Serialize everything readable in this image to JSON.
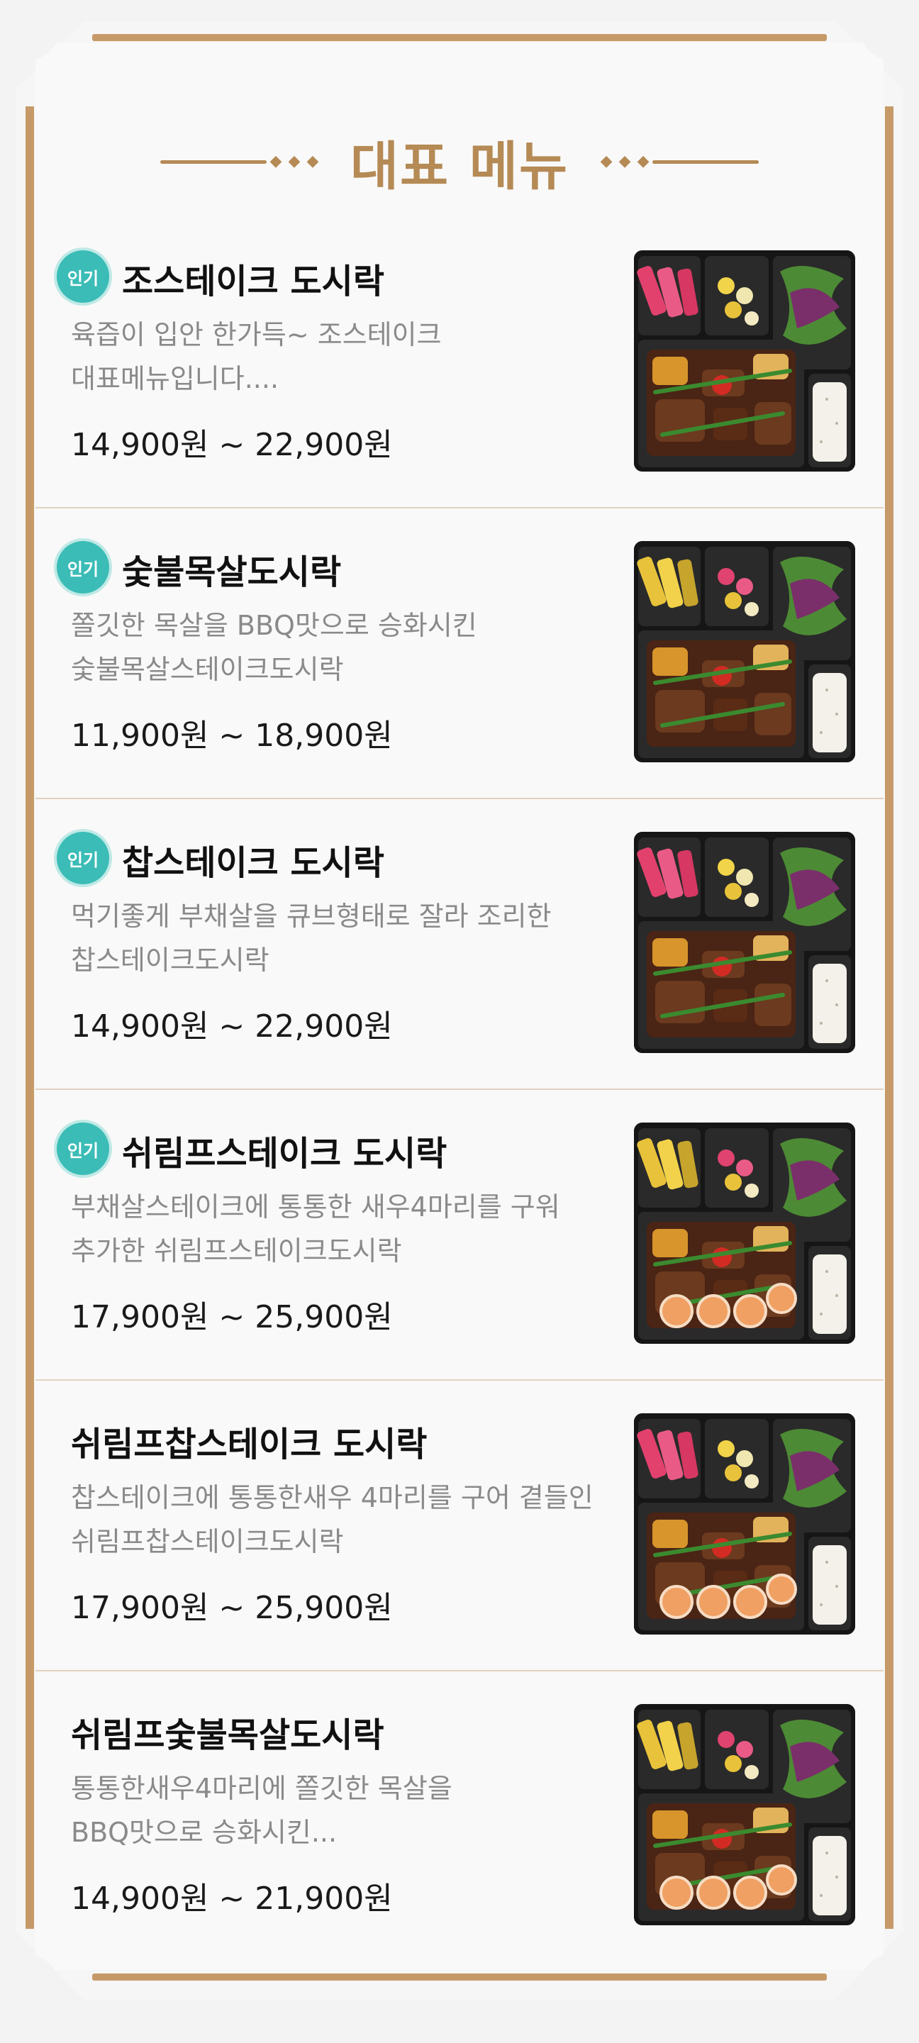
{
  "section": {
    "title": "대표 메뉴",
    "accent_color": "#b58a55",
    "badge_color": "#3bbcb6"
  },
  "menu": [
    {
      "badge": "인기",
      "name": "조스테이크 도시락",
      "desc_line1": "육즙이 입안 한가득~ 조스테이크",
      "desc_line2": "대표메뉴입니다....",
      "price": "14,900원 ~ 22,900원",
      "image_icon": "lunchbox-steak-image"
    },
    {
      "badge": "인기",
      "name": "숯불목살도시락",
      "desc_line1": "쫄깃한 목살을 BBQ맛으로 승화시킨",
      "desc_line2": "숯불목살스테이크도시락",
      "price": "11,900원 ~ 18,900원",
      "image_icon": "lunchbox-pork-neck-image"
    },
    {
      "badge": "인기",
      "name": "찹스테이크 도시락",
      "desc_line1": "먹기좋게 부채살을 큐브형태로 잘라 조리한",
      "desc_line2": "찹스테이크도시락",
      "price": "14,900원 ~ 22,900원",
      "image_icon": "lunchbox-chop-steak-image"
    },
    {
      "badge": "인기",
      "name": "쉬림프스테이크 도시락",
      "desc_line1": "부채살스테이크에 통통한 새우4마리를 구워",
      "desc_line2": "추가한 쉬림프스테이크도시락",
      "price": "17,900원 ~ 25,900원",
      "image_icon": "lunchbox-shrimp-steak-image"
    },
    {
      "badge": "",
      "name": "쉬림프찹스테이크 도시락",
      "desc_line1": "찹스테이크에 통통한새우 4마리를 구어 곁들인",
      "desc_line2": "쉬림프찹스테이크도시락",
      "price": "17,900원 ~ 25,900원",
      "image_icon": "lunchbox-shrimp-chop-steak-image"
    },
    {
      "badge": "",
      "name": "쉬림프숯불목살도시락",
      "desc_line1": "통통한새우4마리에 쫄깃한 목살을",
      "desc_line2": "BBQ맛으로 승화시킨...",
      "price": "14,900원 ~ 21,900원",
      "image_icon": "lunchbox-shrimp-pork-neck-image"
    }
  ]
}
